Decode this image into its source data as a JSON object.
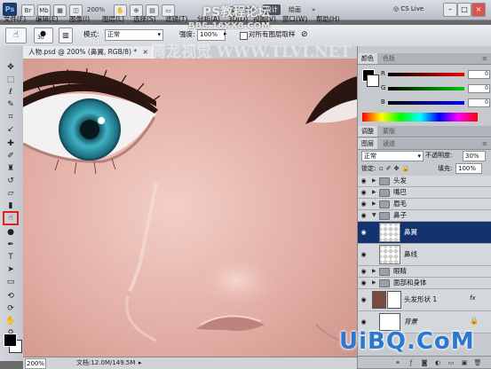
{
  "app": {
    "logo": "Ps",
    "zoom_select": "200%",
    "workspaces": [
      "基本功能",
      "设计",
      "绘画"
    ],
    "cs_live": "CS Live",
    "win_minimize": "–",
    "win_restore": "□",
    "win_close": "×"
  },
  "menu": [
    "文件(F)",
    "编辑(E)",
    "图像(I)",
    "图层(L)",
    "选择(S)",
    "滤镜(T)",
    "分析(A)",
    "3D(D)",
    "视图(V)",
    "窗口(W)",
    "帮助(H)"
  ],
  "options_bar": {
    "brush_size": "30",
    "mode_label": "模式:",
    "mode_value": "正常",
    "strength_label": "强度:",
    "strength_value": "100%",
    "sample_all_label": "对所有图层取样",
    "icon": "smudge-tool-icon"
  },
  "document": {
    "tab_title": "人物.psd @ 200% (鼻翼, RGB/8) *",
    "tab_close": "×",
    "zoom": "200%",
    "doc_info": "文档:12.0M/149.5M"
  },
  "toolbox": {
    "tools": [
      "move-tool-icon",
      "marquee-tool-icon",
      "lasso-tool-icon",
      "quick-select-tool-icon",
      "crop-tool-icon",
      "eyedropper-tool-icon",
      "healing-tool-icon",
      "brush-tool-icon",
      "clone-stamp-tool-icon",
      "history-brush-tool-icon",
      "eraser-tool-icon",
      "gradient-tool-icon",
      "smudge-tool-icon",
      "dodge-tool-icon",
      "pen-tool-icon",
      "type-tool-icon",
      "path-select-tool-icon",
      "shape-tool-icon",
      "3d-rotate-tool-icon",
      "3d-camera-tool-icon",
      "hand-tool-icon",
      "zoom-tool-icon"
    ],
    "active_tool": "smudge-tool-icon",
    "foreground_color": "#000000",
    "background_color": "#ffffff"
  },
  "color_panel": {
    "tabs": [
      "颜色",
      "色板"
    ],
    "sliders": [
      {
        "label": "R",
        "value": "0",
        "color": "#cc2a2a"
      },
      {
        "label": "G",
        "value": "0",
        "color": "#2aa02a"
      },
      {
        "label": "B",
        "value": "0",
        "color": "#2a3fcc"
      }
    ]
  },
  "adjust_panel": {
    "tabs": [
      "调整",
      "蒙版"
    ]
  },
  "layers_panel": {
    "tabs": [
      "图层",
      "通道"
    ],
    "blend_mode": "正常",
    "opacity_label": "不透明度:",
    "opacity_value": "30%",
    "lock_label": "锁定:",
    "fill_label": "填充:",
    "fill_value": "100%",
    "layers": [
      {
        "name": "头发",
        "type": "group",
        "selected": false
      },
      {
        "name": "嘴巴",
        "type": "group",
        "selected": false
      },
      {
        "name": "眉毛",
        "type": "group",
        "selected": false
      },
      {
        "name": "鼻子",
        "type": "group-open",
        "selected": false
      },
      {
        "name": "鼻翼",
        "type": "layer",
        "selected": true
      },
      {
        "name": "鼻线",
        "type": "layer",
        "selected": false
      },
      {
        "name": "眼睛",
        "type": "group",
        "selected": false
      },
      {
        "name": "面部和身体",
        "type": "group",
        "selected": false
      },
      {
        "name": "头发形状 1",
        "type": "shape",
        "selected": false
      },
      {
        "name": "背景",
        "type": "background",
        "selected": false
      }
    ],
    "fx_label": "fx"
  },
  "watermarks": {
    "top": "PS教程论坛",
    "top2": "BBS.16XX8.COM",
    "mid": "腾龙视觉 WWW.TLVI.NET",
    "bottom": "UiBQ.CoM"
  }
}
